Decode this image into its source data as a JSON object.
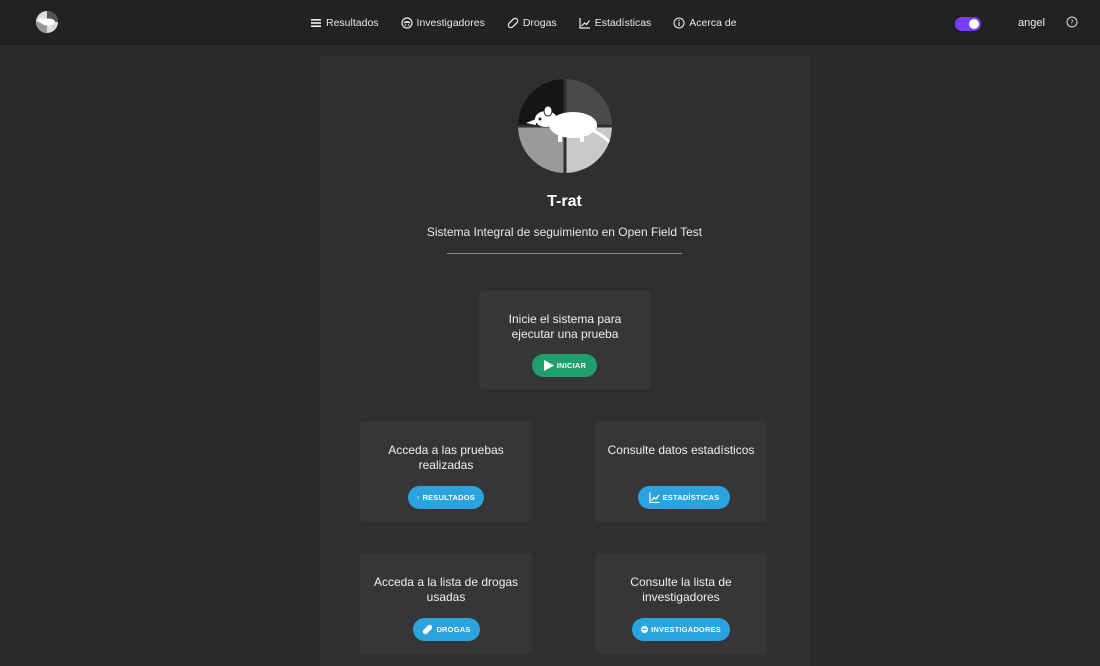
{
  "nav": {
    "items": [
      {
        "label": "Resultados",
        "icon": "list-icon"
      },
      {
        "label": "Investigadores",
        "icon": "investigator-icon"
      },
      {
        "label": "Drogas",
        "icon": "pill-icon"
      },
      {
        "label": "Estadísticas",
        "icon": "chart-icon"
      },
      {
        "label": "Acerca de",
        "icon": "info-icon"
      }
    ],
    "user": "angel",
    "theme_toggle_on": true,
    "accent": "#7a3cff"
  },
  "hero": {
    "title": "T-rat",
    "subtitle": "Sistema Integral de seguimiento en Open Field Test"
  },
  "cards": {
    "start": {
      "text": "Inicie el sistema para ejecutar una prueba",
      "button": "INICIAR"
    },
    "results": {
      "text": "Acceda a las pruebas realizadas",
      "button": "RESULTADOS"
    },
    "stats": {
      "text": "Consulte datos estadísticos",
      "button": "ESTADÍSTICAS"
    },
    "drugs": {
      "text": "Acceda a la lista de drogas usadas",
      "button": "DROGAS"
    },
    "investigators": {
      "text": "Consulte la lista de investigadores",
      "button": "INVESTIGADORES"
    }
  },
  "colors": {
    "green": "#1f9f6e",
    "blue": "#2aa3de"
  }
}
